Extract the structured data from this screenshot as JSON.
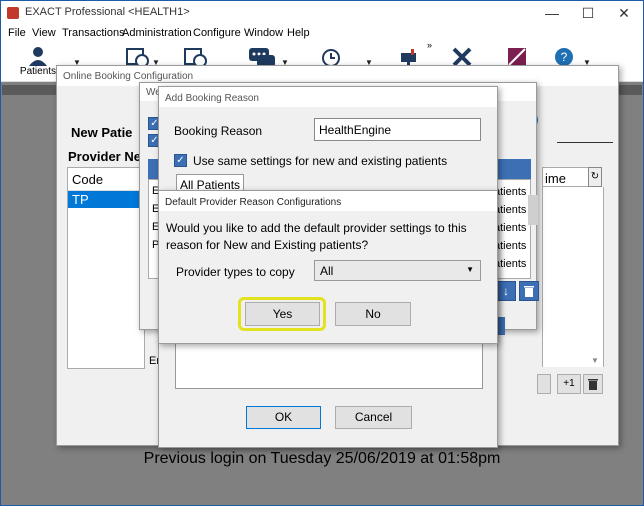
{
  "window": {
    "title": "EXACT Professional <HEALTH1>",
    "minimize": "—",
    "maximize": "☐",
    "close": "✕"
  },
  "menu": [
    "File",
    "View",
    "Transactions",
    "Administration",
    "Configure",
    "Window",
    "Help"
  ],
  "toolbar": {
    "patients_label": "Patients",
    "overflow": "»"
  },
  "online_booking": {
    "title": "Online Booking Configuration",
    "new_patient_heading": "New Patie",
    "provider_heading": "Provider Ne",
    "code_header": "Code",
    "code_row": "TP",
    "time_header": "ime",
    "e_label": "Er",
    "help_icon_text": "?"
  },
  "web_dialog": {
    "title_fragment": "We"
  },
  "side_list": [
    "atients",
    "atients",
    "atients",
    "atients",
    "atients"
  ],
  "left_list": [
    "E",
    "E",
    "E",
    "P"
  ],
  "add_booking_reason": {
    "title": "Add Booking Reason",
    "reason_label": "Booking Reason",
    "reason_value": "HealthEngine",
    "same_settings_label": "Use same settings for new and existing patients",
    "all_patients_tab": "All Patients",
    "ok_label": "OK",
    "cancel_label": "Cancel"
  },
  "default_provider": {
    "title": "Default Provider Reason Configurations",
    "question": "Would you like to add the default provider settings to this reason for New and Existing patients?",
    "types_label": "Provider types to copy",
    "types_value": "All",
    "yes_label": "Yes",
    "no_label": "No"
  },
  "side_buttons": {
    "plus_one": "+1"
  },
  "status_message": "Previous login on Tuesday 25/06/2019 at 01:58pm",
  "colors": {
    "accent": "#0078d7",
    "highlight_ring": "#e2e21e",
    "checkbox": "#3c6fb4"
  }
}
